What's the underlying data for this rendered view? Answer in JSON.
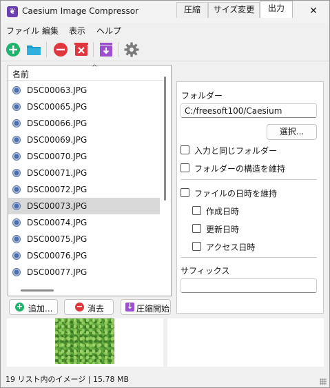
{
  "window": {
    "title": "Caesium Image Compressor",
    "minimize_icon": "minimize-icon",
    "maximize_icon": "maximize-icon",
    "close_icon": "close-icon",
    "min_glyph": "—",
    "max_glyph": "☐",
    "close_glyph": "✕"
  },
  "menu": [
    "ファイル",
    "編集",
    "表示",
    "ヘルプ"
  ],
  "toolbar": {
    "icons": [
      "add-icon",
      "open-folder-icon",
      "remove-icon",
      "clear-list-icon",
      "compress-icon",
      "settings-icon"
    ],
    "colors": {
      "green": "#1fb36b",
      "folder": "#1f9ec9",
      "red": "#e0373e",
      "purple": "#9b4fd1",
      "gear": "#7a7a7a"
    }
  },
  "file_list": {
    "column_header": "名前",
    "sort_glyph": "^",
    "items": [
      "DSC00063.JPG",
      "DSC00065.JPG",
      "DSC00066.JPG",
      "DSC00069.JPG",
      "DSC00070.JPG",
      "DSC00071.JPG",
      "DSC00072.JPG",
      "DSC00073.JPG",
      "DSC00074.JPG",
      "DSC00075.JPG",
      "DSC00076.JPG",
      "DSC00077.JPG"
    ],
    "selected_index": 7
  },
  "actions": {
    "add_label": "追加...",
    "remove_label": "消去",
    "compress_label": "圧縮開始",
    "add_glyph": "+",
    "remove_glyph": "−",
    "compress_glyph": "↓"
  },
  "tabs": [
    "圧縮",
    "サイズ変更",
    "出力"
  ],
  "active_tab": 2,
  "output": {
    "folder_label": "フォルダー",
    "folder_value": "C:/freesoft100/Caesium",
    "browse_label": "選択...",
    "same_as_input": "入力と同じフォルダー",
    "keep_structure": "フォルダーの構造を維持",
    "keep_dates": "ファイルの日時を維持",
    "created_date": "作成日時",
    "modified_date": "更新日時",
    "access_date": "アクセス日時",
    "suffix_label": "サフィックス",
    "suffix_value": ""
  },
  "status_bar": "19 リスト内のイメージ | 15.78 MB"
}
